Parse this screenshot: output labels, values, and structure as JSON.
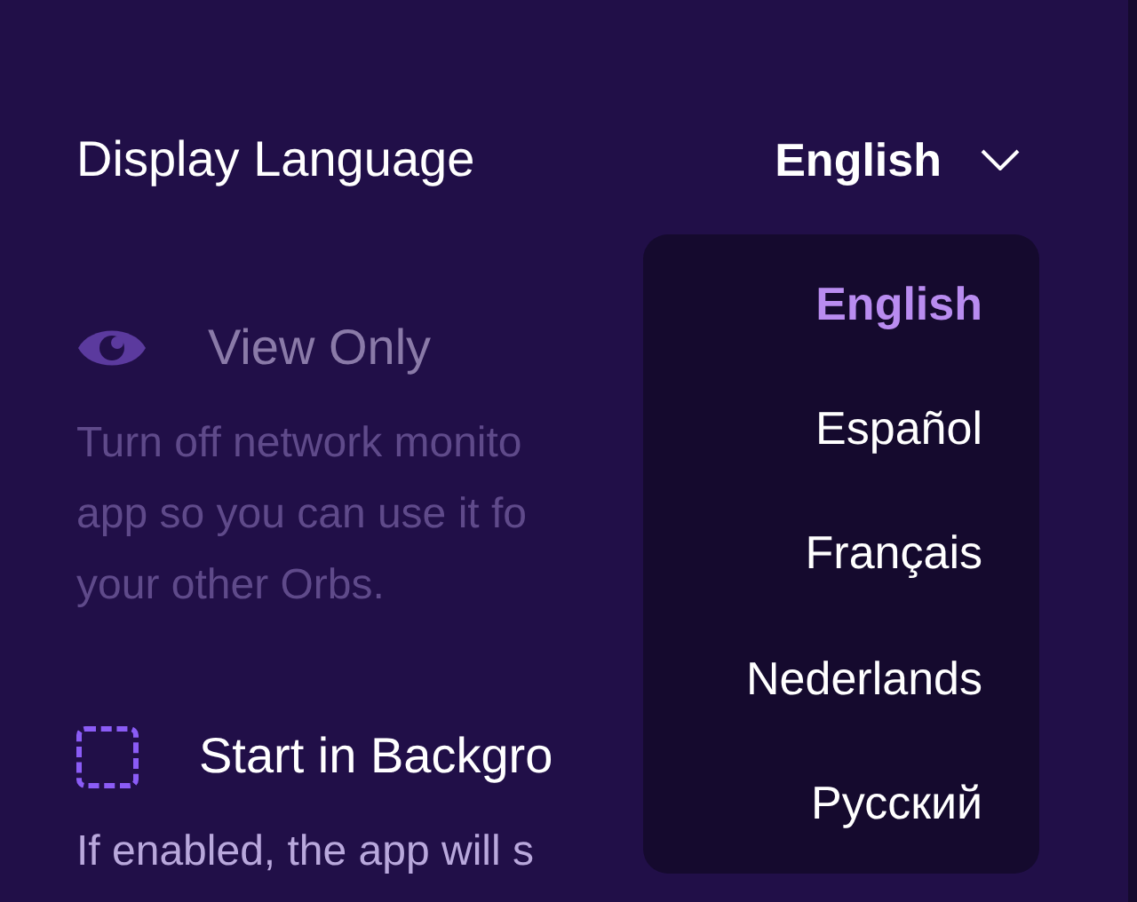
{
  "display_language": {
    "label": "Display Language",
    "value": "English",
    "expanded": true
  },
  "language_menu": [
    {
      "label": "English",
      "selected": true
    },
    {
      "label": "Español",
      "selected": false
    },
    {
      "label": "Français",
      "selected": false
    },
    {
      "label": "Nederlands",
      "selected": false
    },
    {
      "label": "Русский",
      "selected": false
    }
  ],
  "settings": [
    {
      "kind": "view",
      "title": "View Only",
      "disabled": true,
      "description_lines": [
        "Turn off network monito",
        "app so you can use it fo",
        "your other Orbs."
      ]
    },
    {
      "kind": "checkbox",
      "title": "Start in Backgro",
      "checked": false,
      "disabled": false,
      "description_lines": [
        "If enabled, the app will s"
      ]
    }
  ]
}
